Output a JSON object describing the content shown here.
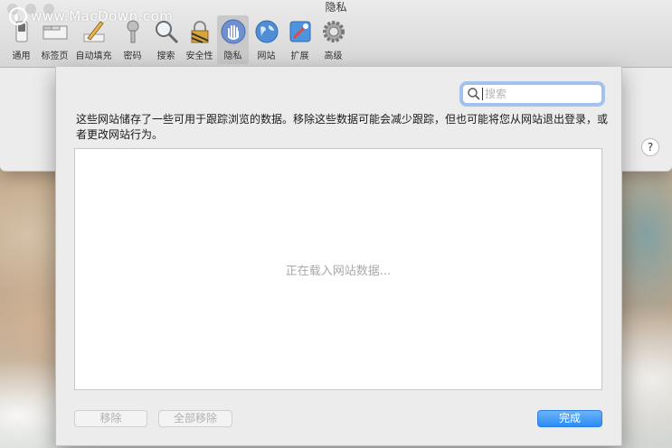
{
  "window": {
    "title": "隐私"
  },
  "watermark": {
    "logo_glyph": "◐",
    "text": "www.MacDown.com"
  },
  "toolbar": {
    "items": [
      {
        "label": "通用",
        "icon": "switch-icon",
        "selected": false
      },
      {
        "label": "标签页",
        "icon": "tabs-icon",
        "selected": false
      },
      {
        "label": "自动填充",
        "icon": "pencil-icon",
        "selected": false
      },
      {
        "label": "密码",
        "icon": "key-icon",
        "selected": false
      },
      {
        "label": "搜索",
        "icon": "magnifier-icon",
        "selected": false
      },
      {
        "label": "安全性",
        "icon": "lock-icon",
        "selected": false
      },
      {
        "label": "隐私",
        "icon": "hand-icon",
        "selected": true
      },
      {
        "label": "网站",
        "icon": "globe-icon",
        "selected": false
      },
      {
        "label": "扩展",
        "icon": "puzzle-icon",
        "selected": false
      },
      {
        "label": "高级",
        "icon": "gear-icon",
        "selected": false
      }
    ]
  },
  "help": {
    "label": "?"
  },
  "sheet": {
    "search": {
      "placeholder": "搜索",
      "value": ""
    },
    "description": "这些网站储存了一些可用于跟踪浏览的数据。移除这些数据可能会减少跟踪，但也可能将您从网站退出登录，或者更改网站行为。",
    "loading_text": "正在载入网站数据...",
    "buttons": {
      "remove": "移除",
      "remove_all": "全部移除",
      "done": "完成"
    }
  },
  "colors": {
    "accent": "#2b8cf5",
    "selected_tool_bg": "#c9c9c9",
    "focus_ring": "#69a0eb"
  }
}
